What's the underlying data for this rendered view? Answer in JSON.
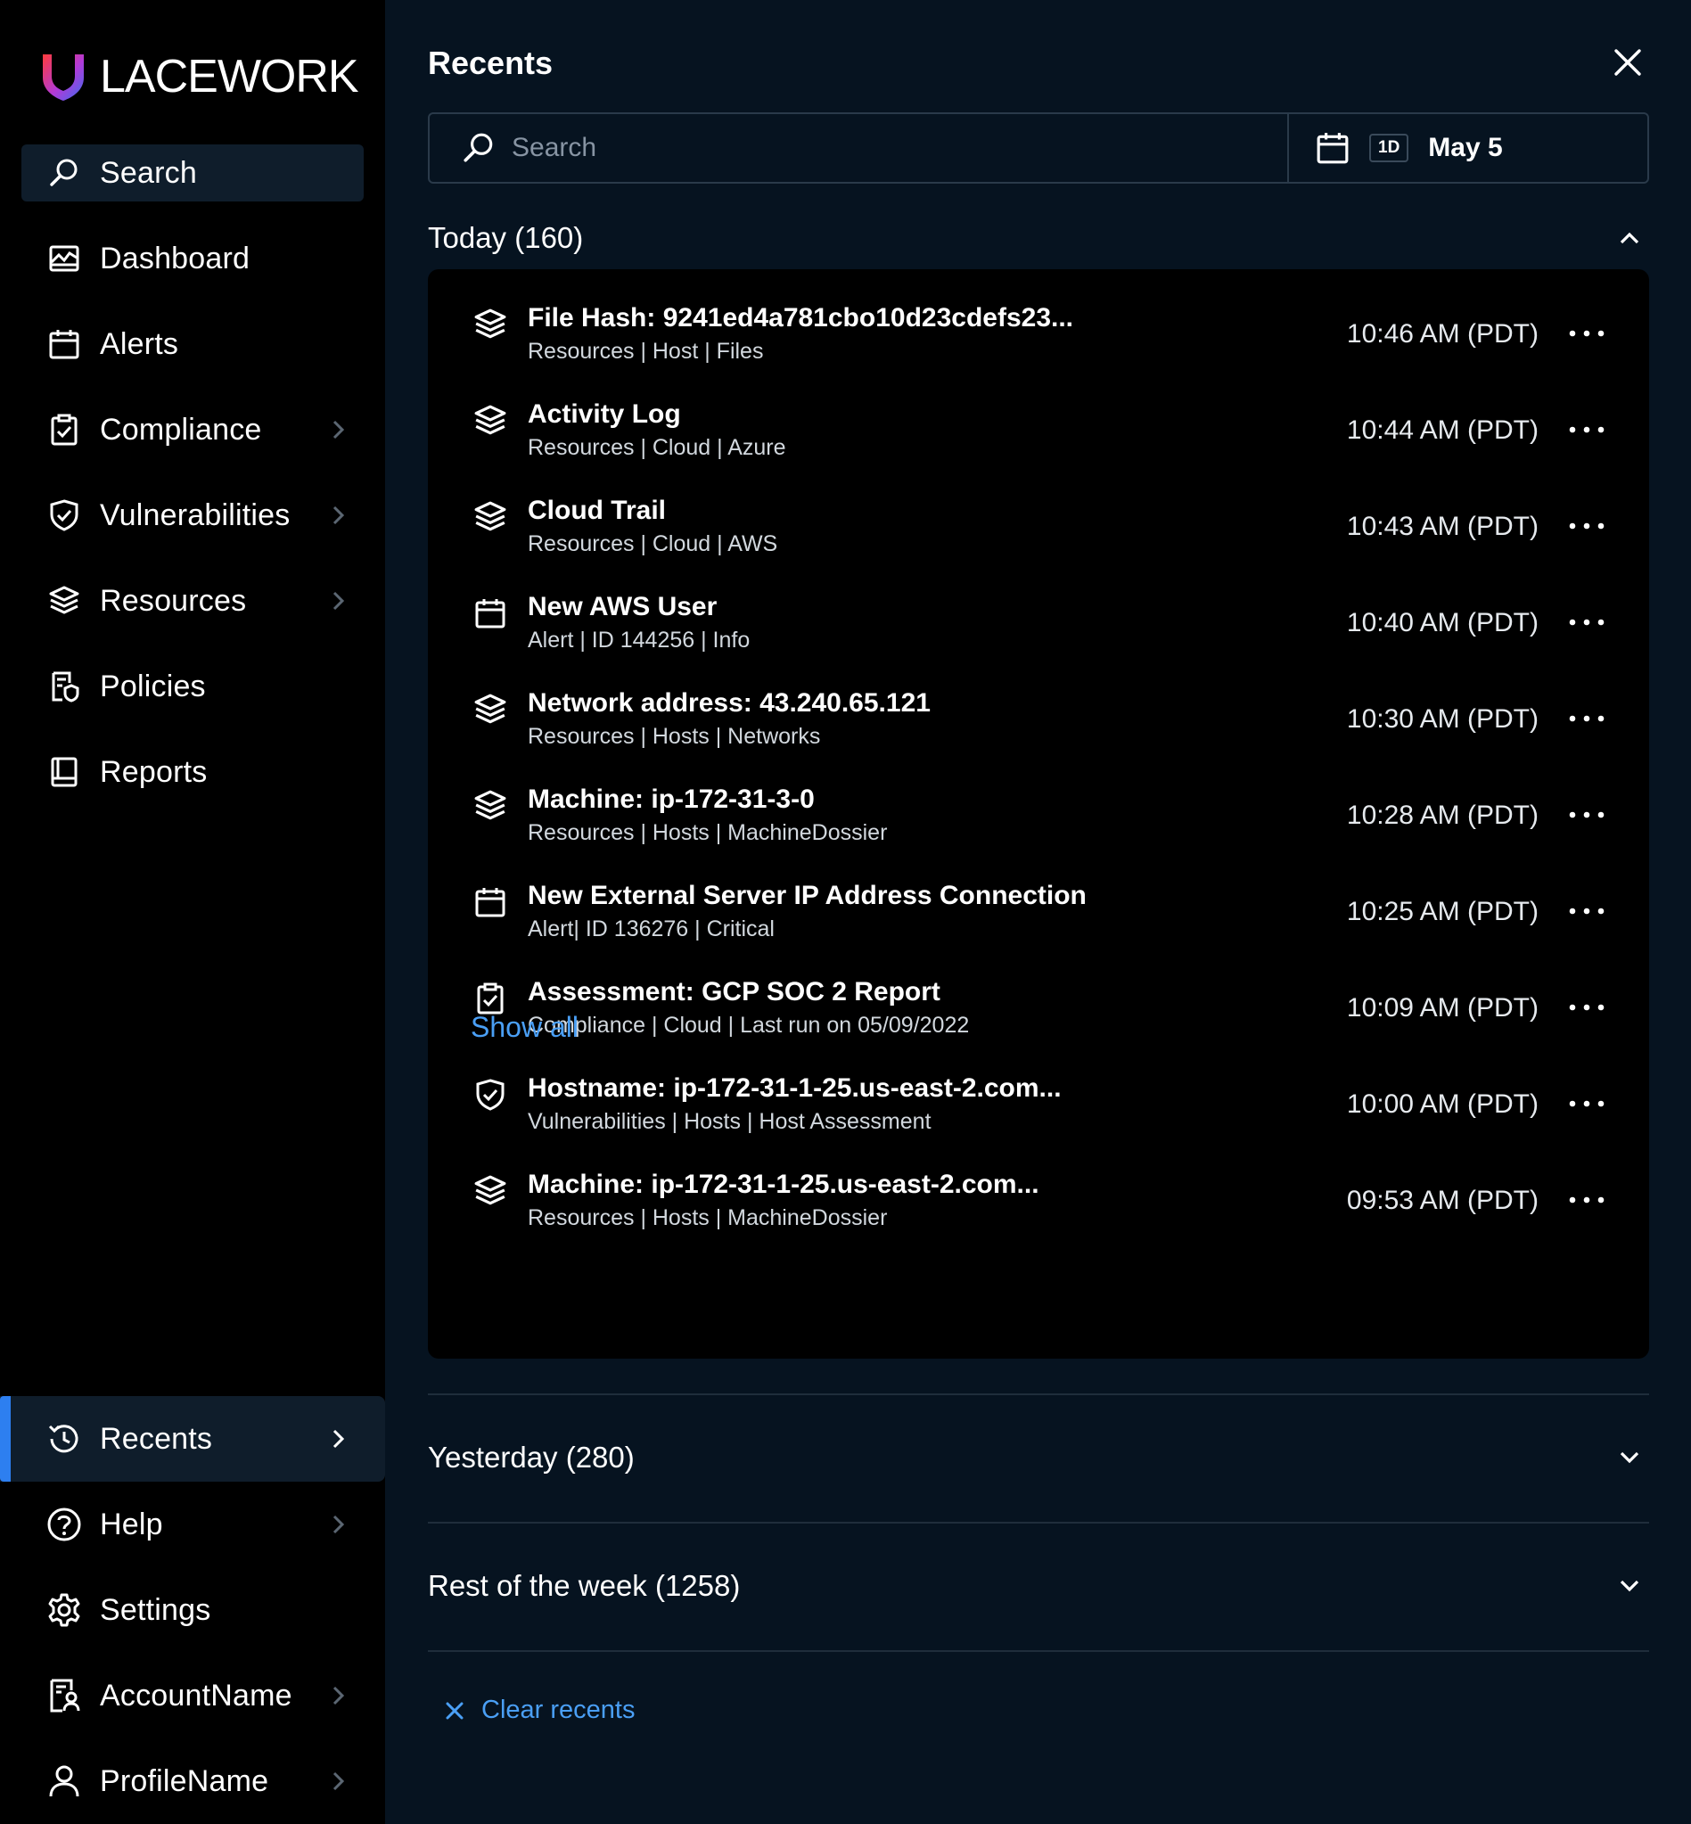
{
  "brand": {
    "name": "LACEWORK"
  },
  "sidebar": {
    "items": [
      {
        "label": "Search",
        "icon": "search-icon"
      },
      {
        "label": "Dashboard",
        "icon": "dashboard-icon"
      },
      {
        "label": "Alerts",
        "icon": "calendar-icon"
      },
      {
        "label": "Compliance",
        "icon": "clipboard-check-icon",
        "has_chevron": true
      },
      {
        "label": "Vulnerabilities",
        "icon": "shield-check-icon",
        "has_chevron": true
      },
      {
        "label": "Resources",
        "icon": "layers-icon",
        "has_chevron": true
      },
      {
        "label": "Policies",
        "icon": "policy-icon"
      },
      {
        "label": "Reports",
        "icon": "book-icon"
      }
    ],
    "bottom_items": [
      {
        "label": "Recents",
        "icon": "history-icon",
        "has_chevron": true,
        "active": true
      },
      {
        "label": "Help",
        "icon": "help-icon",
        "has_chevron": true
      },
      {
        "label": "Settings",
        "icon": "gear-icon"
      },
      {
        "label": "AccountName",
        "icon": "account-icon",
        "has_chevron": true
      },
      {
        "label": "ProfileName",
        "icon": "user-icon",
        "has_chevron": true
      }
    ]
  },
  "panel": {
    "title": "Recents",
    "search": {
      "placeholder": "Search",
      "value": ""
    },
    "date_filter": {
      "range": "1D",
      "date": "May 5"
    },
    "sections": {
      "today": {
        "label": "Today (160)",
        "expanded": true
      },
      "yesterday": {
        "label": "Yesterday (280)",
        "expanded": false
      },
      "week": {
        "label": "Rest of the week (1258)",
        "expanded": false
      }
    },
    "today_items": [
      {
        "title": "File Hash: 9241ed4a781cbo10d23cdefs23...",
        "subtitle": "Resources | Host | Files",
        "time": "10:46 AM (PDT)",
        "icon": "layers-icon"
      },
      {
        "title": "Activity Log",
        "subtitle": "Resources | Cloud | Azure",
        "time": "10:44 AM (PDT)",
        "icon": "layers-icon"
      },
      {
        "title": "Cloud Trail",
        "subtitle": "Resources | Cloud | AWS",
        "time": "10:43 AM (PDT)",
        "icon": "layers-icon"
      },
      {
        "title": "New AWS User",
        "subtitle": "Alert | ID 144256 | Info",
        "time": "10:40 AM (PDT)",
        "icon": "calendar-icon"
      },
      {
        "title": "Network address: 43.240.65.121",
        "subtitle": "Resources | Hosts | Networks",
        "time": "10:30 AM (PDT)",
        "icon": "layers-icon"
      },
      {
        "title": "Machine: ip-172-31-3-0",
        "subtitle": "Resources | Hosts | MachineDossier",
        "time": "10:28 AM (PDT)",
        "icon": "layers-icon"
      },
      {
        "title": "New External Server IP Address Connection",
        "subtitle": "Alert| ID 136276 | Critical",
        "time": "10:25 AM (PDT)",
        "icon": "calendar-icon"
      },
      {
        "title": "Assessment: GCP SOC 2 Report",
        "subtitle": "Compliance | Cloud | Last run on 05/09/2022",
        "time": "10:09 AM (PDT)",
        "icon": "clipboard-check-icon"
      },
      {
        "title": "Hostname: ip-172-31-1-25.us-east-2.com...",
        "subtitle": "Vulnerabilities | Hosts | Host Assessment",
        "time": "10:00 AM (PDT)",
        "icon": "shield-check-icon"
      },
      {
        "title": "Machine: ip-172-31-1-25.us-east-2.com...",
        "subtitle": "Resources | Hosts | MachineDossier",
        "time": "09:53 AM (PDT)",
        "icon": "layers-icon"
      }
    ],
    "show_all_label": "Show all",
    "clear_recents_label": "Clear recents"
  },
  "colors": {
    "accent": "#2d7ff0",
    "link": "#4a9ff5",
    "panel_bg": "#061320",
    "sidebar_bg": "#000000"
  }
}
